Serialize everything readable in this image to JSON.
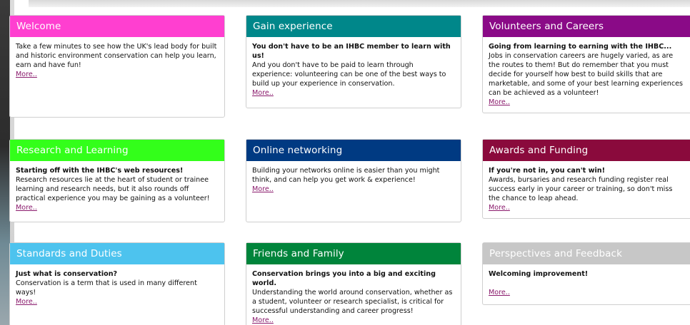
{
  "colors": {
    "welcome": "#ff3fd0",
    "gain": "#00878a",
    "volunteers": "#8a0a87",
    "research": "#33ff1a",
    "networking": "#003a82",
    "awards": "#8a0a3c",
    "standards": "#4dc3ee",
    "friends": "#00843b",
    "perspectives": "#c7c7c7",
    "link": "#8a1a6c"
  },
  "cards": [
    {
      "title": "Welcome",
      "lead": "",
      "body": "Take a few minutes to see how the UK's lead body for built and historic environment conservation can help you learn, earn and have fun!",
      "more": "More.."
    },
    {
      "title": "Gain experience",
      "lead": "You don't have to be an IHBC member to learn with us!",
      "body": "And you don't have to be paid to learn through experience: volunteering can be one of the best ways to build up your experience in conservation.",
      "more": "More.."
    },
    {
      "title": "Volunteers and Careers",
      "lead": "Going from learning to earning with the IHBC...",
      "body": "Jobs in conservation careers are hugely varied, as are the routes to them! But do remember that you must decide for yourself how best to build skills that are marketable, and some of your best learning experiences can be achieved as a volunteer!",
      "more": "More.."
    },
    {
      "title": "Research and Learning",
      "lead": "Starting off with the IHBC's web resources!",
      "body": "Research resources lie at the heart of student or trainee learning and research needs, but it also rounds off practical experience you may be gaining as a volunteer!",
      "more": "More.."
    },
    {
      "title": "Online networking",
      "lead": "",
      "body": "Building your networks online is easier than you might think, and can help you get work & experience!",
      "more": "More.."
    },
    {
      "title": "Awards and Funding",
      "lead": "If you're not in, you can't win!",
      "body": "Awards, bursaries and research funding register real success early in your career or training, so don't miss the chance to leap ahead.",
      "more": "More.."
    },
    {
      "title": "Standards and Duties",
      "lead": "Just what is conservation?",
      "body": "Conservation is a term that is used in many different ways!",
      "more": "More.."
    },
    {
      "title": "Friends and Family",
      "lead": "Conservation brings you into a big and exciting world.",
      "body": "Understanding the world around conservation, whether as a student, volunteer or research specialist, is critical for successful understanding and career progress!",
      "more": "More.."
    },
    {
      "title": "Perspectives and Feedback",
      "lead": "Welcoming improvement!",
      "body": "",
      "more": "More.."
    }
  ]
}
